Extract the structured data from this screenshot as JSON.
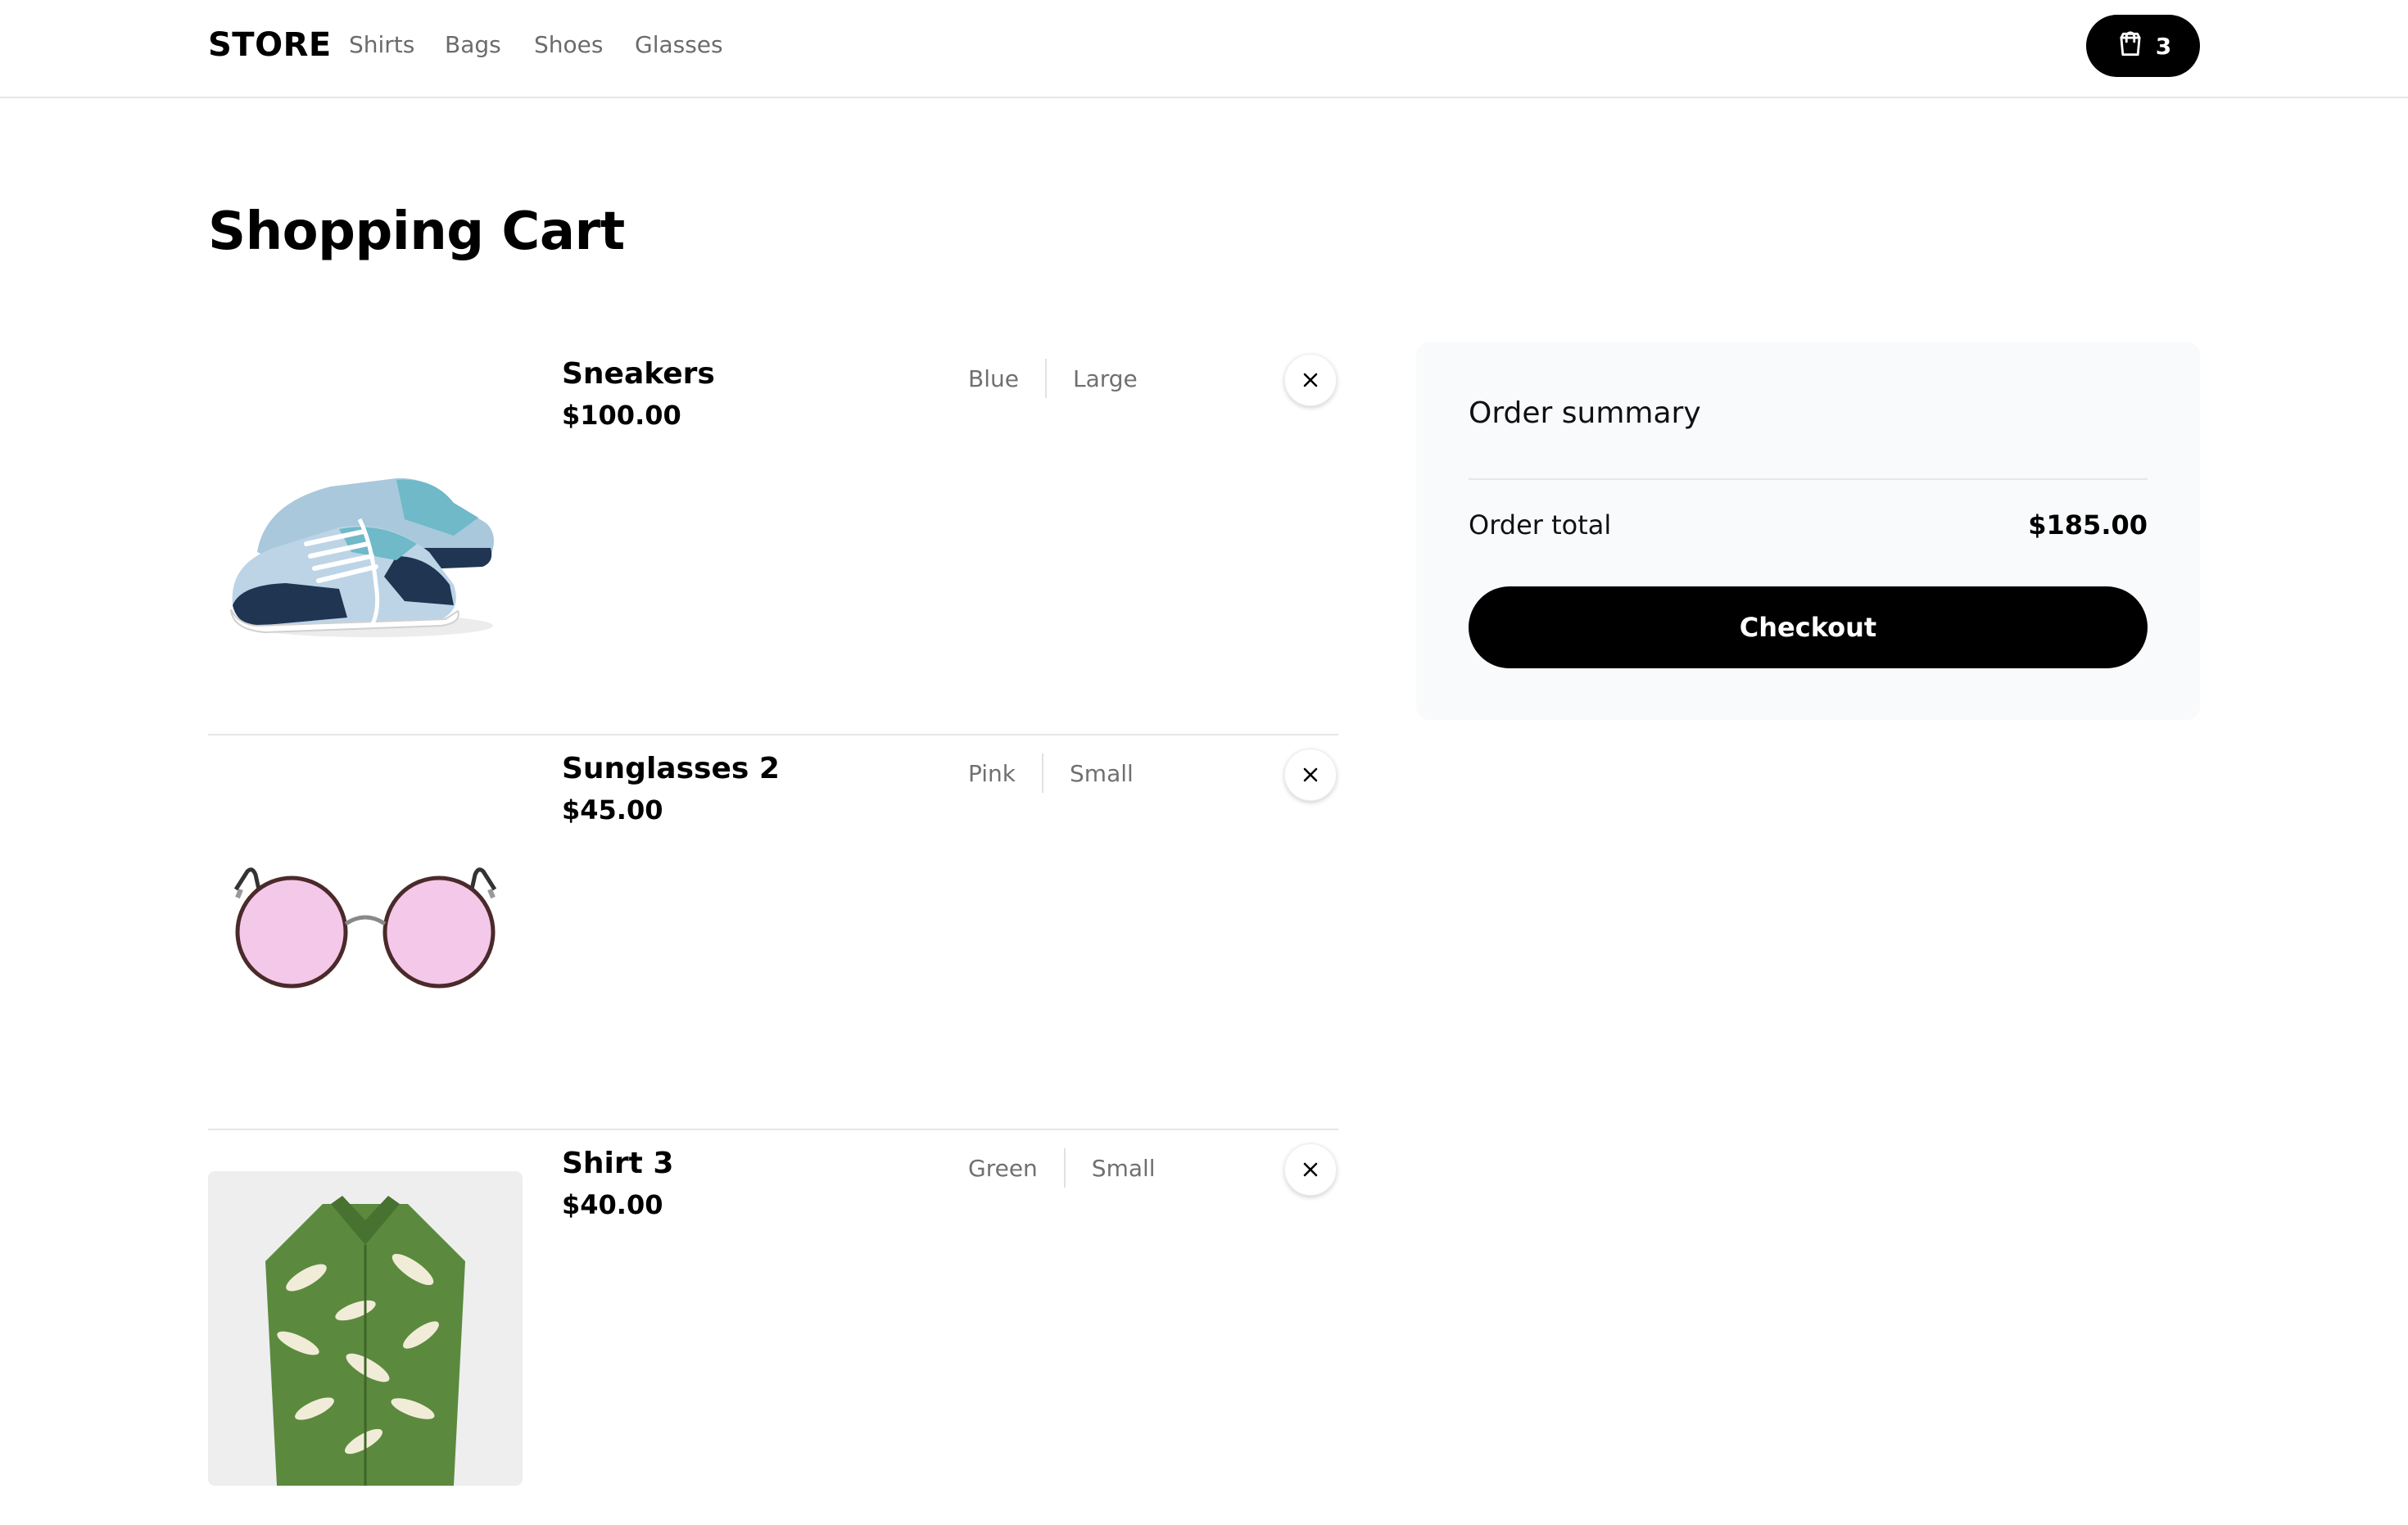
{
  "header": {
    "logo": "STORE",
    "nav": [
      "Shirts",
      "Bags",
      "Shoes",
      "Glasses"
    ],
    "cart_count": "3",
    "cart_icon": "shopping-bag-icon"
  },
  "page": {
    "title": "Shopping Cart"
  },
  "cart": {
    "items": [
      {
        "name": "Sneakers",
        "price": "$100.00",
        "color": "Blue",
        "size": "Large"
      },
      {
        "name": "Sunglasses 2",
        "price": "$45.00",
        "color": "Pink",
        "size": "Small"
      },
      {
        "name": "Shirt 3",
        "price": "$40.00",
        "color": "Green",
        "size": "Small"
      }
    ],
    "remove_icon": "close-icon"
  },
  "summary": {
    "title": "Order summary",
    "total_label": "Order total",
    "total_value": "$185.00",
    "checkout_label": "Checkout"
  },
  "colors": {
    "primary": "#000000",
    "summary_bg": "#f9fafb",
    "muted_text": "#707070",
    "border": "#e6e6e6"
  }
}
